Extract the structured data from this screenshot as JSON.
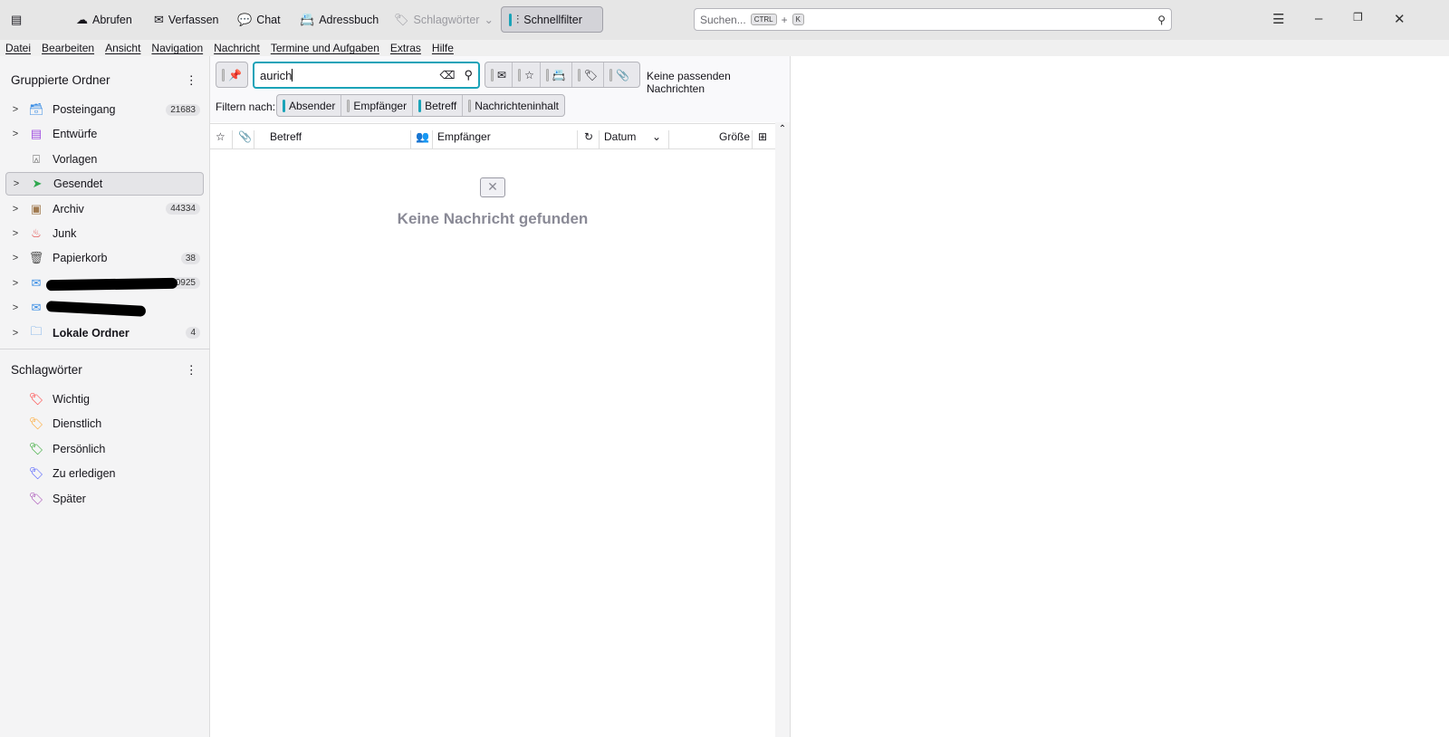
{
  "toolbar": {
    "abrufen": "Abrufen",
    "verfassen": "Verfassen",
    "chat": "Chat",
    "adressbuch": "Adressbuch",
    "schlagwoerter": "Schlagwörter",
    "schnellfilter": "Schnellfilter"
  },
  "search": {
    "placeholder": "Suchen...",
    "kbd1": "CTRL",
    "plus": "+",
    "kbd2": "K"
  },
  "menu": [
    "Datei",
    "Bearbeiten",
    "Ansicht",
    "Navigation",
    "Nachricht",
    "Termine und Aufgaben",
    "Extras",
    "Hilfe"
  ],
  "sidebar": {
    "folders_title": "Gruppierte Ordner",
    "folders": [
      {
        "label": "Posteingang",
        "count": "21683",
        "icon": "inbox-icon",
        "color": "#3b8ee5"
      },
      {
        "label": "Entwürfe",
        "count": "",
        "icon": "drafts-icon",
        "color": "#a04fe0"
      },
      {
        "label": "Vorlagen",
        "count": "",
        "icon": "templates-icon",
        "color": "#555"
      },
      {
        "label": "Gesendet",
        "count": "",
        "icon": "sent-icon",
        "color": "#2fa84f"
      },
      {
        "label": "Archiv",
        "count": "44334",
        "icon": "archive-icon",
        "color": "#a07a50"
      },
      {
        "label": "Junk",
        "count": "",
        "icon": "junk-icon",
        "color": "#e04040"
      },
      {
        "label": "Papierkorb",
        "count": "38",
        "icon": "trash-icon",
        "color": "#555"
      },
      {
        "label": "",
        "count": "0925",
        "icon": "account-icon",
        "color": "#3b8ee5"
      },
      {
        "label": "",
        "count": "",
        "icon": "account-icon",
        "color": "#3b8ee5"
      },
      {
        "label": "Lokale Ordner",
        "count": "4",
        "icon": "folder-icon",
        "color": "#3b8ee5"
      }
    ],
    "tags_title": "Schlagwörter",
    "tags": [
      {
        "label": "Wichtig",
        "color": "#ff3030"
      },
      {
        "label": "Dienstlich",
        "color": "#ffa020"
      },
      {
        "label": "Persönlich",
        "color": "#20a020"
      },
      {
        "label": "Zu erledigen",
        "color": "#4050ff"
      },
      {
        "label": "Später",
        "color": "#a040b0"
      }
    ]
  },
  "quickfilter": {
    "search_value": "aurich",
    "status": "Keine passenden Nachrichten",
    "filter_label": "Filtern nach:",
    "filters": [
      {
        "label": "Absender",
        "on": true
      },
      {
        "label": "Empfänger",
        "on": false
      },
      {
        "label": "Betreff",
        "on": true
      },
      {
        "label": "Nachrichteninhalt",
        "on": false
      }
    ]
  },
  "columns": {
    "subject": "Betreff",
    "recipient": "Empfänger",
    "date": "Datum",
    "size": "Größe"
  },
  "empty": {
    "message": "Keine Nachricht gefunden"
  }
}
